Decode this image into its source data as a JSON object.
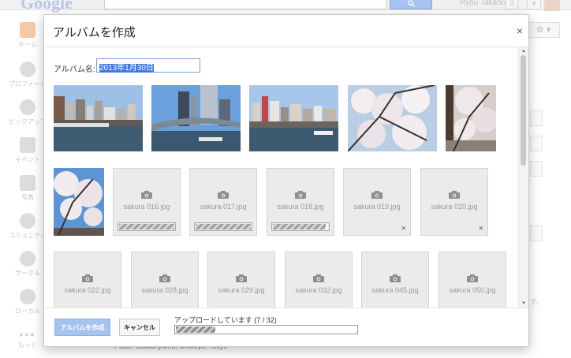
{
  "app": {
    "logo": "Google",
    "logo_plus": "+",
    "user_name": "Ryou Takano",
    "notifications": "0",
    "share_symbol": "+"
  },
  "sidebar": {
    "items": [
      {
        "label": "ホーム",
        "icon": "home-icon"
      },
      {
        "label": "プロフィール",
        "icon": "profile-icon"
      },
      {
        "label": "ピックアップ",
        "icon": "explore-icon"
      },
      {
        "label": "イベント",
        "icon": "events-icon"
      },
      {
        "label": "写真",
        "icon": "photos-icon"
      },
      {
        "label": "コミュニティ",
        "icon": "communities-icon"
      },
      {
        "label": "サークル",
        "icon": "circles-icon"
      },
      {
        "label": "ローカル",
        "icon": "local-icon"
      },
      {
        "label": "もっと",
        "icon": "more-icon"
      }
    ]
  },
  "background": {
    "gear_caret": "▾",
    "side_text": "す。",
    "place_text": "Place: Daikanyama, Shibuya, Tokyo"
  },
  "dialog": {
    "title": "アルバムを作成",
    "close_symbol": "×",
    "album_name_label": "アルバム名:",
    "album_name_value": "2013年1月30日",
    "photos_done": [
      {
        "alt": "river-skyline-1"
      },
      {
        "alt": "river-bridge"
      },
      {
        "alt": "river-skyline-2"
      },
      {
        "alt": "sakura-branches"
      },
      {
        "alt": "sakura-tree"
      },
      {
        "alt": "sakura-blossom-sky"
      }
    ],
    "uploading": [
      {
        "file": "sakura 016.jpg",
        "progress": 1.0,
        "status": "uploading"
      },
      {
        "file": "sakura 017.jpg",
        "progress": 1.0,
        "status": "uploading"
      },
      {
        "file": "sakura 018.jpg",
        "progress": 0.95,
        "status": "uploading"
      },
      {
        "file": "sakura 019.jpg",
        "progress": 0,
        "status": "queued"
      },
      {
        "file": "sakura 020.jpg",
        "progress": 0,
        "status": "queued"
      },
      {
        "file": "sakura 022.jpg",
        "progress": 0,
        "status": "queued"
      },
      {
        "file": "sakura 028.jpg",
        "progress": 0,
        "status": "queued"
      },
      {
        "file": "sakura 029.jpg",
        "progress": 0,
        "status": "queued"
      },
      {
        "file": "sakura 032.jpg",
        "progress": 0,
        "status": "queued"
      },
      {
        "file": "sakura 045.jpg",
        "progress": 0,
        "status": "queued"
      },
      {
        "file": "sakura 050.jpg",
        "progress": 0,
        "status": "queued"
      }
    ],
    "remove_symbol": "×",
    "footer": {
      "create_label": "アルバムを作成",
      "cancel_label": "キャンセル",
      "upload_status": "アップロードしています (7 / 32)",
      "upload_progress": 0.22
    }
  }
}
